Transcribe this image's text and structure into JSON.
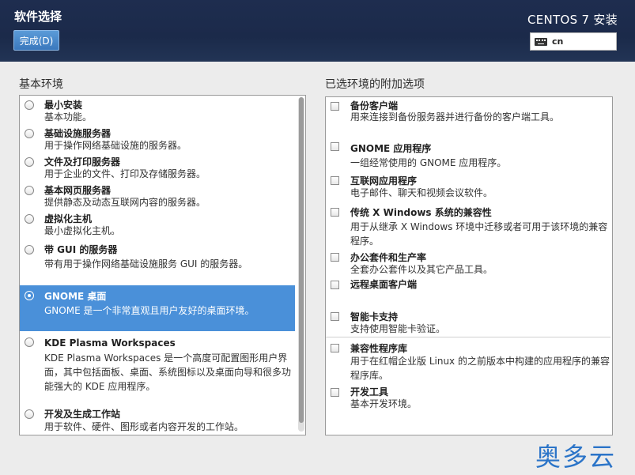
{
  "header": {
    "title": "软件选择",
    "done_button": "完成(D)",
    "install_title": "CENTOS 7 安装",
    "keyboard_layout": "cn"
  },
  "base_env": {
    "label": "基本环境",
    "items": [
      {
        "name": "最小安装",
        "desc": "基本功能。",
        "selected": false
      },
      {
        "name": "基础设施服务器",
        "desc": "用于操作网络基础设施的服务器。",
        "selected": false
      },
      {
        "name": "文件及打印服务器",
        "desc": "用于企业的文件、打印及存储服务器。",
        "selected": false
      },
      {
        "name": "基本网页服务器",
        "desc": "提供静态及动态互联网内容的服务器。",
        "selected": false
      },
      {
        "name": "虚拟化主机",
        "desc": "最小虚拟化主机。",
        "selected": false
      },
      {
        "name": "带 GUI 的服务器",
        "desc": "带有用于操作网络基础设施服务 GUI 的服务器。",
        "selected": false
      },
      {
        "name": "GNOME 桌面",
        "desc": "GNOME 是一个非常直观且用户友好的桌面环境。",
        "selected": true
      },
      {
        "name": "KDE Plasma Workspaces",
        "desc": "KDE Plasma Workspaces 是一个高度可配置图形用户界面，其中包括面板、桌面、系统图标以及桌面向导和很多功能强大的 KDE 应用程序。",
        "selected": false
      },
      {
        "name": "开发及生成工作站",
        "desc": "用于软件、硬件、图形或者内容开发的工作站。",
        "selected": false
      }
    ]
  },
  "addons": {
    "label": "已选环境的附加选项",
    "items": [
      {
        "name": "备份客户端",
        "desc": "用来连接到备份服务器并进行备份的客户端工具。",
        "checked": false
      },
      {
        "name": "GNOME 应用程序",
        "desc": "一组经常使用的 GNOME 应用程序。",
        "checked": false
      },
      {
        "name": "互联网应用程序",
        "desc": "电子邮件、聊天和视频会议软件。",
        "checked": false
      },
      {
        "name": "传统 X Windows 系统的兼容性",
        "desc": "用于从继承 X Windows 环境中迁移或者可用于该环境的兼容程序。",
        "checked": false
      },
      {
        "name": "办公套件和生产率",
        "desc": "全套办公套件以及其它产品工具。",
        "checked": false
      },
      {
        "name": "远程桌面客户端",
        "desc": "",
        "checked": false
      },
      {
        "name": "智能卡支持",
        "desc": "支持使用智能卡验证。",
        "checked": false
      },
      {
        "name": "兼容性程序库",
        "desc": "用于在红帽企业版 Linux 的之前版本中构建的应用程序的兼容程序库。",
        "checked": false
      },
      {
        "name": "开发工具",
        "desc": "基本开发环境。",
        "checked": false
      }
    ]
  },
  "watermark": "奥多云"
}
